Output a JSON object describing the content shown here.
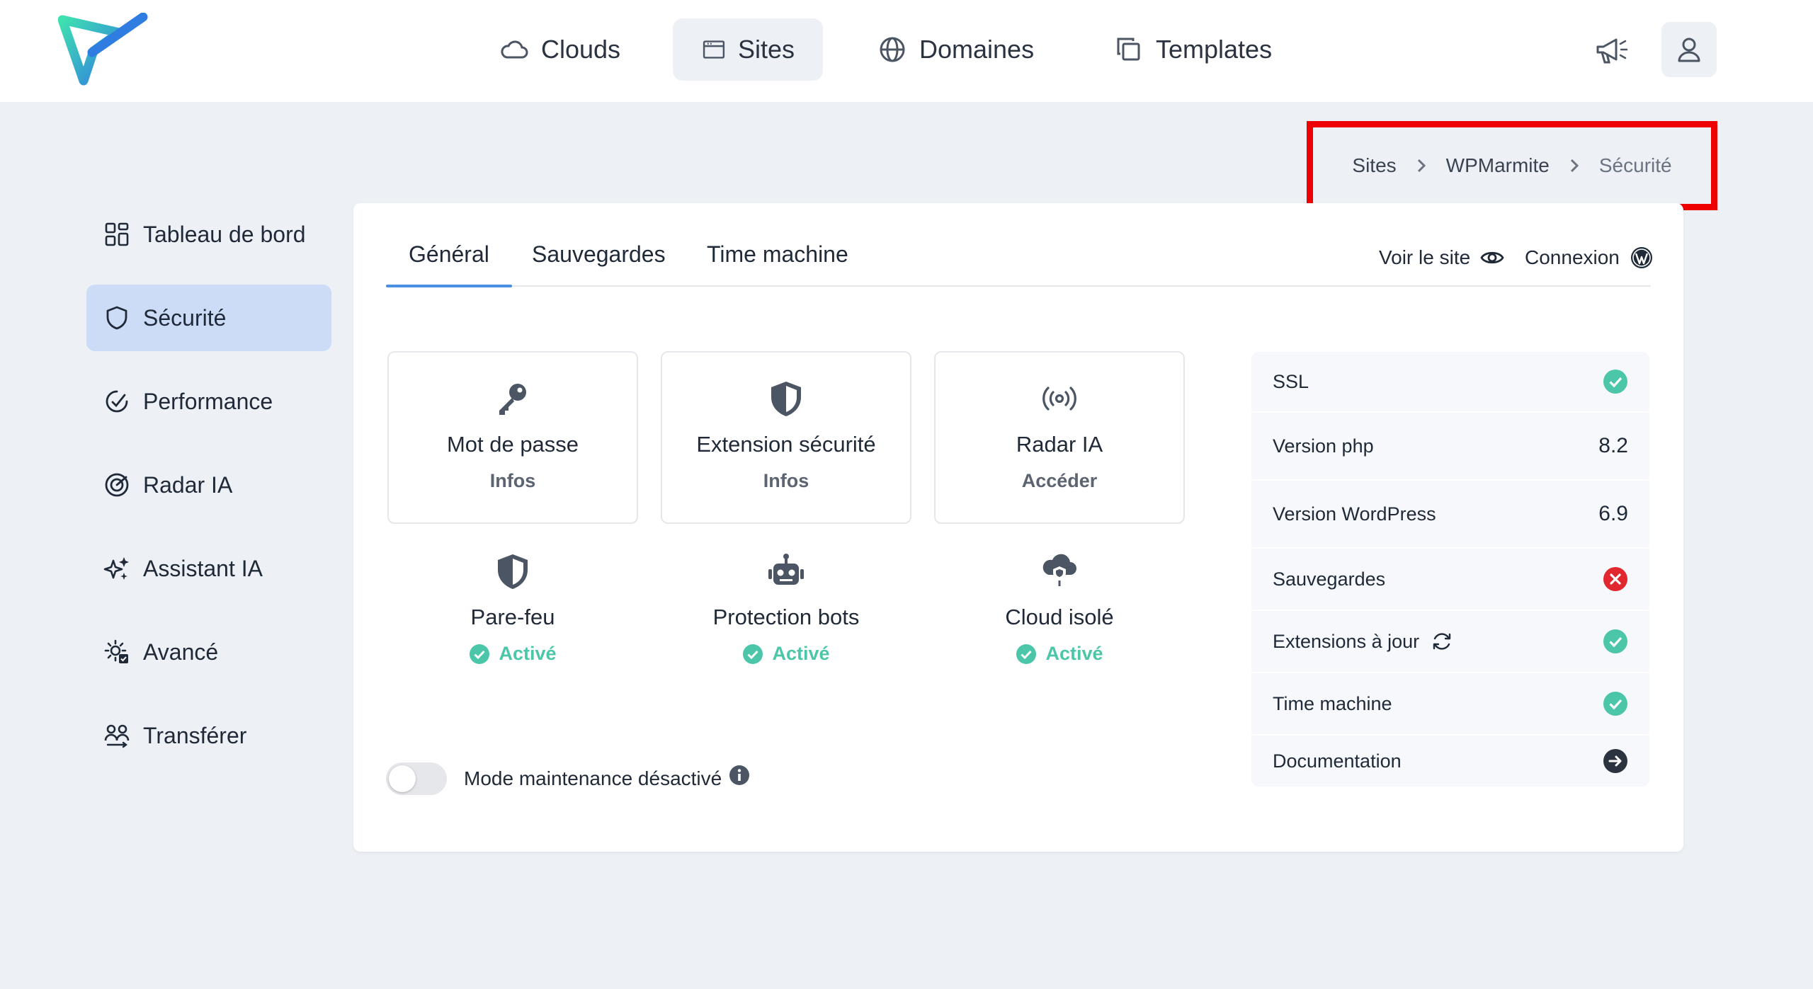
{
  "topbar": {
    "nav": [
      {
        "label": "Clouds",
        "icon": "cloud-icon"
      },
      {
        "label": "Sites",
        "icon": "browser-window-icon",
        "active": true
      },
      {
        "label": "Domaines",
        "icon": "globe-icon"
      },
      {
        "label": "Templates",
        "icon": "copy-icon"
      }
    ]
  },
  "breadcrumb": [
    "Sites",
    "WPMarmite",
    "Sécurité"
  ],
  "sidebar": {
    "items": [
      {
        "label": "Tableau de bord",
        "icon": "dashboard-icon"
      },
      {
        "label": "Sécurité",
        "icon": "shield-icon",
        "active": true
      },
      {
        "label": "Performance",
        "icon": "gauge-icon"
      },
      {
        "label": "Radar IA",
        "icon": "radar-icon"
      },
      {
        "label": "Assistant IA",
        "icon": "sparkles-icon"
      },
      {
        "label": "Avancé",
        "icon": "gear-check-icon"
      },
      {
        "label": "Transférer",
        "icon": "users-transfer-icon"
      }
    ]
  },
  "tabs": [
    {
      "label": "Général",
      "active": true
    },
    {
      "label": "Sauvegardes"
    },
    {
      "label": "Time machine"
    }
  ],
  "actions": {
    "view_site": "Voir le site",
    "login": "Connexion"
  },
  "features": [
    {
      "title": "Mot de passe",
      "sub": "Infos",
      "icon": "key-icon"
    },
    {
      "title": "Extension sécurité",
      "sub": "Infos",
      "icon": "shield-half-icon"
    },
    {
      "title": "Radar IA",
      "sub": "Accéder",
      "icon": "broadcast-icon"
    },
    {
      "title": "Pare-feu",
      "sub": "Activé",
      "icon": "shield-half-icon"
    },
    {
      "title": "Protection bots",
      "sub": "Activé",
      "icon": "robot-icon"
    },
    {
      "title": "Cloud isolé",
      "sub": "Activé",
      "icon": "cloud-shield-icon"
    }
  ],
  "maintenance": {
    "label": "Mode maintenance désactivé",
    "enabled": false
  },
  "status": [
    {
      "label": "SSL",
      "state": "ok"
    },
    {
      "label": "Version php",
      "value": "8.2"
    },
    {
      "label": "Version WordPress",
      "value": "6.9"
    },
    {
      "label": "Sauvegardes",
      "state": "error"
    },
    {
      "label": "Extensions à jour",
      "state": "ok"
    },
    {
      "label": "Time machine",
      "state": "ok"
    },
    {
      "label": "Documentation",
      "state": "link"
    }
  ],
  "colors": {
    "accent": "#4a90e2",
    "success": "#4cc6a8",
    "error": "#e0282e",
    "highlight": "#ef0000",
    "active_bg": "#ccdcf6"
  }
}
